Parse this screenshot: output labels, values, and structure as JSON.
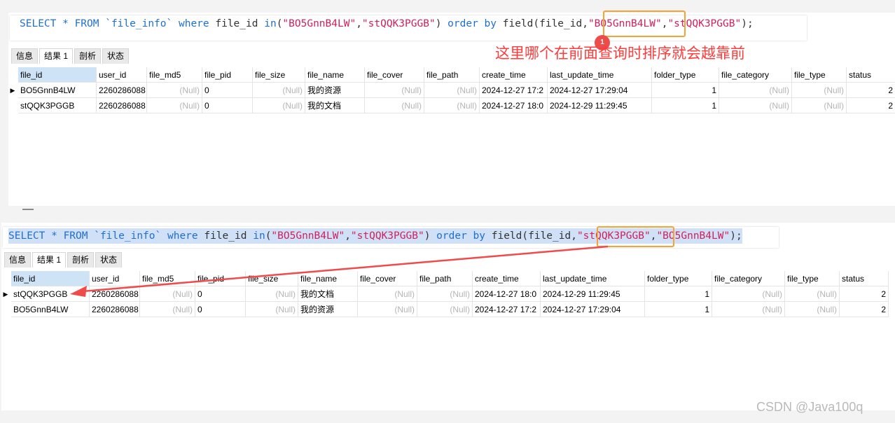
{
  "top": {
    "sql": {
      "p1": "SELECT * FROM `file_info` ",
      "k1": "where",
      "p2": " file_id ",
      "k2": "in",
      "p3": "(",
      "s1": "\"BO5GnnB4LW\"",
      "p4": ",",
      "s2": "\"stQQK3PGGB\"",
      "p5": ") ",
      "k3": "order by",
      "p6": " field(file_id,",
      "s3": "\"BO5GnnB4LW\"",
      "p7": ",",
      "s4": "\"stQQK3PGGB\"",
      "p8": ");"
    },
    "tabs": [
      "信息",
      "结果 1",
      "剖析",
      "状态"
    ],
    "active_tab": 1
  },
  "bottom": {
    "sql": {
      "p1": "SELECT * FROM `file_info` ",
      "k1": "where",
      "p2": " file_id ",
      "k2": "in",
      "p3": "(",
      "s1": "\"BO5GnnB4LW\"",
      "p4": ",",
      "s2": "\"stQQK3PGGB\"",
      "p5": ") ",
      "k3": "order by",
      "p6": " field(file_id,",
      "s3": "\"stQQK3PGGB\"",
      "p7": ",",
      "s4": "\"BO5GnnB4LW\"",
      "p8": ");"
    },
    "tabs": [
      "信息",
      "结果 1",
      "剖析",
      "状态"
    ],
    "active_tab": 1
  },
  "columns": [
    "file_id",
    "user_id",
    "file_md5",
    "file_pid",
    "file_size",
    "file_name",
    "file_cover",
    "file_path",
    "create_time",
    "last_update_time",
    "folder_type",
    "file_category",
    "file_type",
    "status"
  ],
  "top_rows": [
    [
      "BO5GnnB4LW",
      "2260286088",
      "(Null)",
      "0",
      "(Null)",
      "我的资源",
      "(Null)",
      "(Null)",
      "2024-12-27 17:2",
      "2024-12-27 17:29:04",
      "1",
      "(Null)",
      "(Null)",
      "2"
    ],
    [
      "stQQK3PGGB",
      "2260286088",
      "(Null)",
      "0",
      "(Null)",
      "我的文档",
      "(Null)",
      "(Null)",
      "2024-12-27 18:0",
      "2024-12-29 11:29:45",
      "1",
      "(Null)",
      "(Null)",
      "2"
    ]
  ],
  "bottom_rows": [
    [
      "stQQK3PGGB",
      "2260286088",
      "(Null)",
      "0",
      "(Null)",
      "我的文档",
      "(Null)",
      "(Null)",
      "2024-12-27 18:0",
      "2024-12-29 11:29:45",
      "1",
      "(Null)",
      "(Null)",
      "2"
    ],
    [
      "BO5GnnB4LW",
      "2260286088",
      "(Null)",
      "0",
      "(Null)",
      "我的资源",
      "(Null)",
      "(Null)",
      "2024-12-27 17:2",
      "2024-12-27 17:29:04",
      "1",
      "(Null)",
      "(Null)",
      "2"
    ]
  ],
  "annotation": {
    "text": "这里哪个在前面查询时排序就会越靠前",
    "badge": "1",
    "color": "#ff3b3b",
    "box_color": "#f7a234"
  },
  "watermark": "CSDN @Java100q",
  "colors": {
    "keyword": "#1f6fd0",
    "string": "#d0215a",
    "header_selected": "#cfe3f7"
  }
}
